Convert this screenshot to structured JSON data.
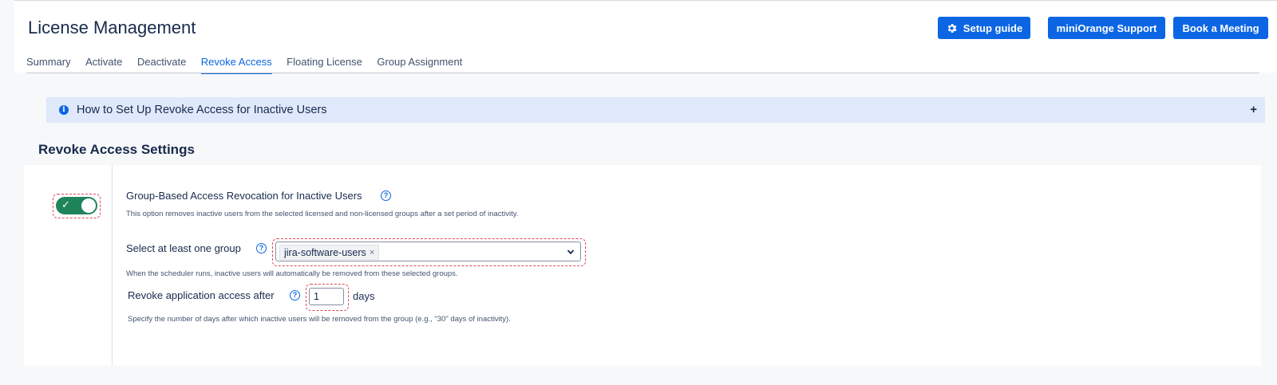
{
  "header": {
    "title": "License Management",
    "buttons": {
      "setup_guide": "Setup guide",
      "support": "miniOrange Support",
      "meeting": "Book a Meeting"
    }
  },
  "tabs": [
    {
      "label": "Summary",
      "active": false
    },
    {
      "label": "Activate",
      "active": false
    },
    {
      "label": "Deactivate",
      "active": false
    },
    {
      "label": "Revoke Access",
      "active": true
    },
    {
      "label": "Floating License",
      "active": false
    },
    {
      "label": "Group Assignment",
      "active": false
    }
  ],
  "info_panel": {
    "title": "How to Set Up Revoke Access for Inactive Users",
    "expand_symbol": "+"
  },
  "settings": {
    "section_title": "Revoke Access Settings",
    "toggle": {
      "enabled": true
    },
    "group_revocation": {
      "label": "Group-Based Access Revocation for Inactive Users",
      "description": "This option removes inactive users from the selected licensed and non-licensed groups after a set period of inactivity."
    },
    "group_select": {
      "label": "Select at least one group",
      "selected": [
        "jira-software-users"
      ],
      "description": "When the scheduler runs, inactive users will automatically be removed from these selected groups."
    },
    "revoke_after": {
      "label": "Revoke application access after",
      "value": "1",
      "unit": "days",
      "description": "Specify the number of days after which inactive users will be removed from the group (e.g., \"30\" days of inactivity)."
    }
  },
  "colors": {
    "primary": "#0c66e4",
    "toggle_on": "#1f845a",
    "highlight_dash": "#e0485a",
    "info_bg": "#dfe9fb"
  },
  "icons": {
    "setup": "gear-icon",
    "info": "info-icon",
    "help": "question-circle-icon",
    "dropdown": "chevron-down-icon",
    "toggle_check": "check-icon",
    "chip_remove": "close-icon"
  }
}
